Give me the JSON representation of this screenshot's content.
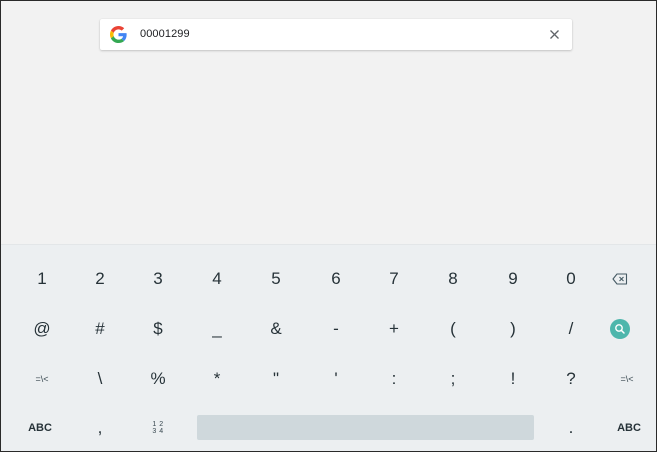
{
  "search": {
    "query": "00001299",
    "icon": "google-g-icon",
    "clear_icon": "close-icon"
  },
  "keyboard": {
    "row1": [
      "1",
      "2",
      "3",
      "4",
      "5",
      "6",
      "7",
      "8",
      "9",
      "0"
    ],
    "row1_end_icon": "backspace-icon",
    "row2": [
      "@",
      "#",
      "$",
      "_",
      "&",
      "-",
      "+",
      "(",
      ")",
      "/"
    ],
    "row2_end_icon": "search-icon",
    "row3_start": "=\\<",
    "row3": [
      "\\",
      "%",
      "*",
      "\"",
      "'",
      ":",
      ";",
      "!",
      "?"
    ],
    "row3_end": "=\\<",
    "row4_left": "ABC",
    "row4_comma": ",",
    "row4_numpad": "1 2\n3 4",
    "row4_period": ".",
    "row4_right": "ABC"
  },
  "colors": {
    "background": "#f2f2f2",
    "keyboard_bg": "#eceff1",
    "key_text": "#263238",
    "spacebar": "#cfd8dc",
    "search_key": "#4db6ac"
  }
}
